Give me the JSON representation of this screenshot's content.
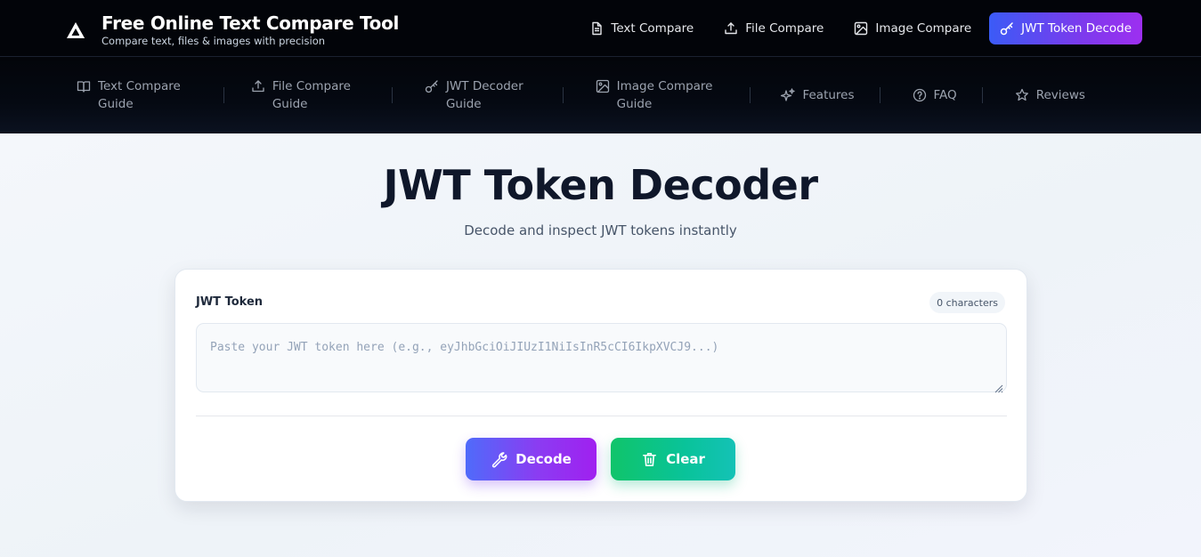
{
  "brand": {
    "title": "Free Online Text Compare Tool",
    "subtitle": "Compare text, files & images with precision",
    "logo_icon": "triangle-logo-icon"
  },
  "topnav": {
    "items": [
      {
        "label": "Text Compare",
        "icon": "document-icon"
      },
      {
        "label": "File Compare",
        "icon": "upload-icon"
      },
      {
        "label": "Image Compare",
        "icon": "image-icon"
      },
      {
        "label": "JWT Token Decode",
        "icon": "key-icon",
        "active": true
      }
    ]
  },
  "subnav": {
    "items": [
      {
        "line1": "Text Compare",
        "line2": "Guide",
        "icon": "book-icon"
      },
      {
        "line1": "File Compare",
        "line2": "Guide",
        "icon": "upload-icon"
      },
      {
        "line1": "JWT Decoder",
        "line2": "Guide",
        "icon": "key-icon"
      },
      {
        "line1": "Image Compare",
        "line2": "Guide",
        "icon": "image-icon"
      },
      {
        "line1": "Features",
        "icon": "sparkles-icon"
      },
      {
        "line1": "FAQ",
        "icon": "help-circle-icon"
      },
      {
        "line1": "Reviews",
        "icon": "star-icon"
      }
    ]
  },
  "hero": {
    "title": "JWT Token Decoder",
    "subtitle": "Decode and inspect JWT tokens instantly"
  },
  "card": {
    "label": "JWT Token",
    "char_count": "0 characters",
    "input_value": "",
    "placeholder": "Paste your JWT token here (e.g., eyJhbGciOiJIUzI1NiIsInR5cCI6IkpXVCJ9...)"
  },
  "buttons": {
    "decode_label": "Decode",
    "decode_icon": "wrench-icon",
    "clear_label": "Clear",
    "clear_icon": "trash-icon"
  },
  "colors": {
    "topbar_bg": "#020409",
    "accent_gradient_start": "#3b5bf6",
    "accent_gradient_end": "#9d2ff0",
    "clear_green": "#10c46a",
    "title_text": "#0f172a"
  }
}
